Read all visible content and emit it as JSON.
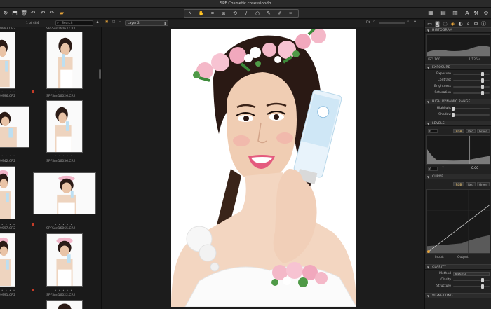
{
  "window": {
    "title": "SPF Cosmetic.cosessiondb"
  },
  "toolbar": {
    "left_icons": [
      "refresh-icon",
      "import-icon",
      "trash-icon",
      "undo-icon",
      "undo-step-icon",
      "redo-icon",
      "folder-icon"
    ],
    "tools": [
      "select-icon",
      "pan-hand-icon",
      "crop-icon",
      "keystone-icon",
      "rotate-icon",
      "straighten-icon",
      "spot-removal-icon",
      "brush-icon",
      "eraser-icon",
      "gradient-icon"
    ],
    "right_icons": [
      "grid-view-icon",
      "compare-icon",
      "export-icon",
      "text-icon",
      "tools-icon",
      "settings-icon"
    ]
  },
  "browser": {
    "counter": "1 of 484",
    "search_placeholder": "Search",
    "thumbnails": [
      {
        "left_label": "9993.CR2",
        "right_label": "SPFSun16063.CR2"
      },
      {
        "left_label": "9996.CR2",
        "right_label": "SPFSun16026.CR2"
      },
      {
        "left_label": "9942.CR2",
        "right_label": "SPFSun16056.CR2"
      },
      {
        "left_label": "9997.CR2",
        "right_label": "SPFSun16065.CR2"
      },
      {
        "left_label": "9991.CR2",
        "right_label": "SPFSun16022.CR2"
      }
    ]
  },
  "viewer": {
    "layer_select": "Layer 2",
    "zoom_label": "Fit"
  },
  "panel": {
    "tabs": [
      "folder-icon",
      "camera-icon",
      "lens-icon",
      "color-icon",
      "exposure-icon",
      "details-icon",
      "adjustments-icon",
      "metadata-icon"
    ],
    "histogram": {
      "title": "HISTOGRAM",
      "iso": "ISO 160",
      "shutter": "1/125 s"
    },
    "exposure": {
      "title": "EXPOSURE",
      "rows": [
        {
          "label": "Exposure",
          "value": 0.5
        },
        {
          "label": "Contrast",
          "value": 0.5
        },
        {
          "label": "Brightness",
          "value": 0.5
        },
        {
          "label": "Saturation",
          "value": 0.5
        }
      ]
    },
    "hdr": {
      "title": "HIGH DYNAMIC RANGE",
      "rows": [
        {
          "label": "Highlight",
          "value": 0.0
        },
        {
          "label": "Shadow",
          "value": 0.0
        }
      ]
    },
    "levels": {
      "title": "LEVELS",
      "channels": [
        "RGB",
        "Red",
        "Green"
      ],
      "selected": "RGB",
      "left_value": "0",
      "right_value": "0.00",
      "bottom_left": "0"
    },
    "curve": {
      "title": "CURVE",
      "channels": [
        "RGB",
        "Red",
        "Green"
      ],
      "selected": "RGB",
      "input_label": "Input:",
      "output_label": "Output:"
    },
    "clarity": {
      "title": "CLARITY",
      "method_label": "Method",
      "method_value": "Natural",
      "rows": [
        {
          "label": "Clarity",
          "value": 0.5
        },
        {
          "label": "Structure",
          "value": 0.5
        }
      ]
    },
    "vignetting": {
      "title": "VIGNETTING"
    }
  }
}
